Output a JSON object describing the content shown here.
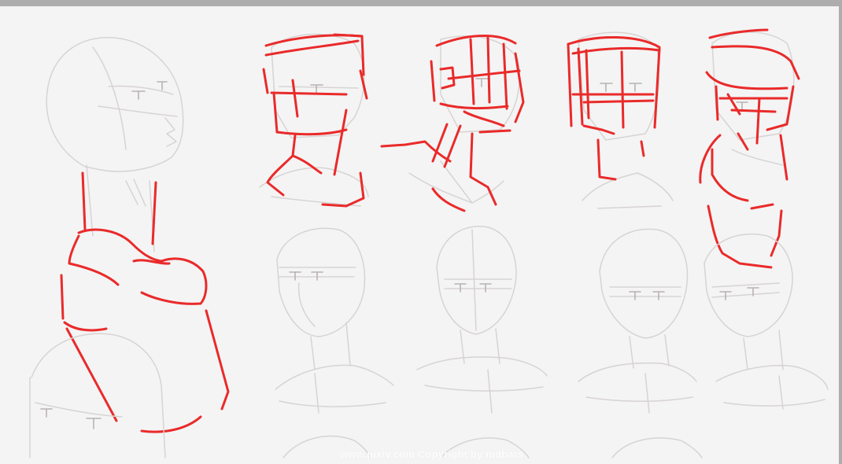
{
  "watermark": {
    "text": "www.pixiv.com Copyright by mdbars"
  },
  "colors": {
    "background": "#f4f4f4",
    "frame": "#adadad",
    "sketch": "#d8d3d3",
    "construction": "#ea2a2a"
  }
}
